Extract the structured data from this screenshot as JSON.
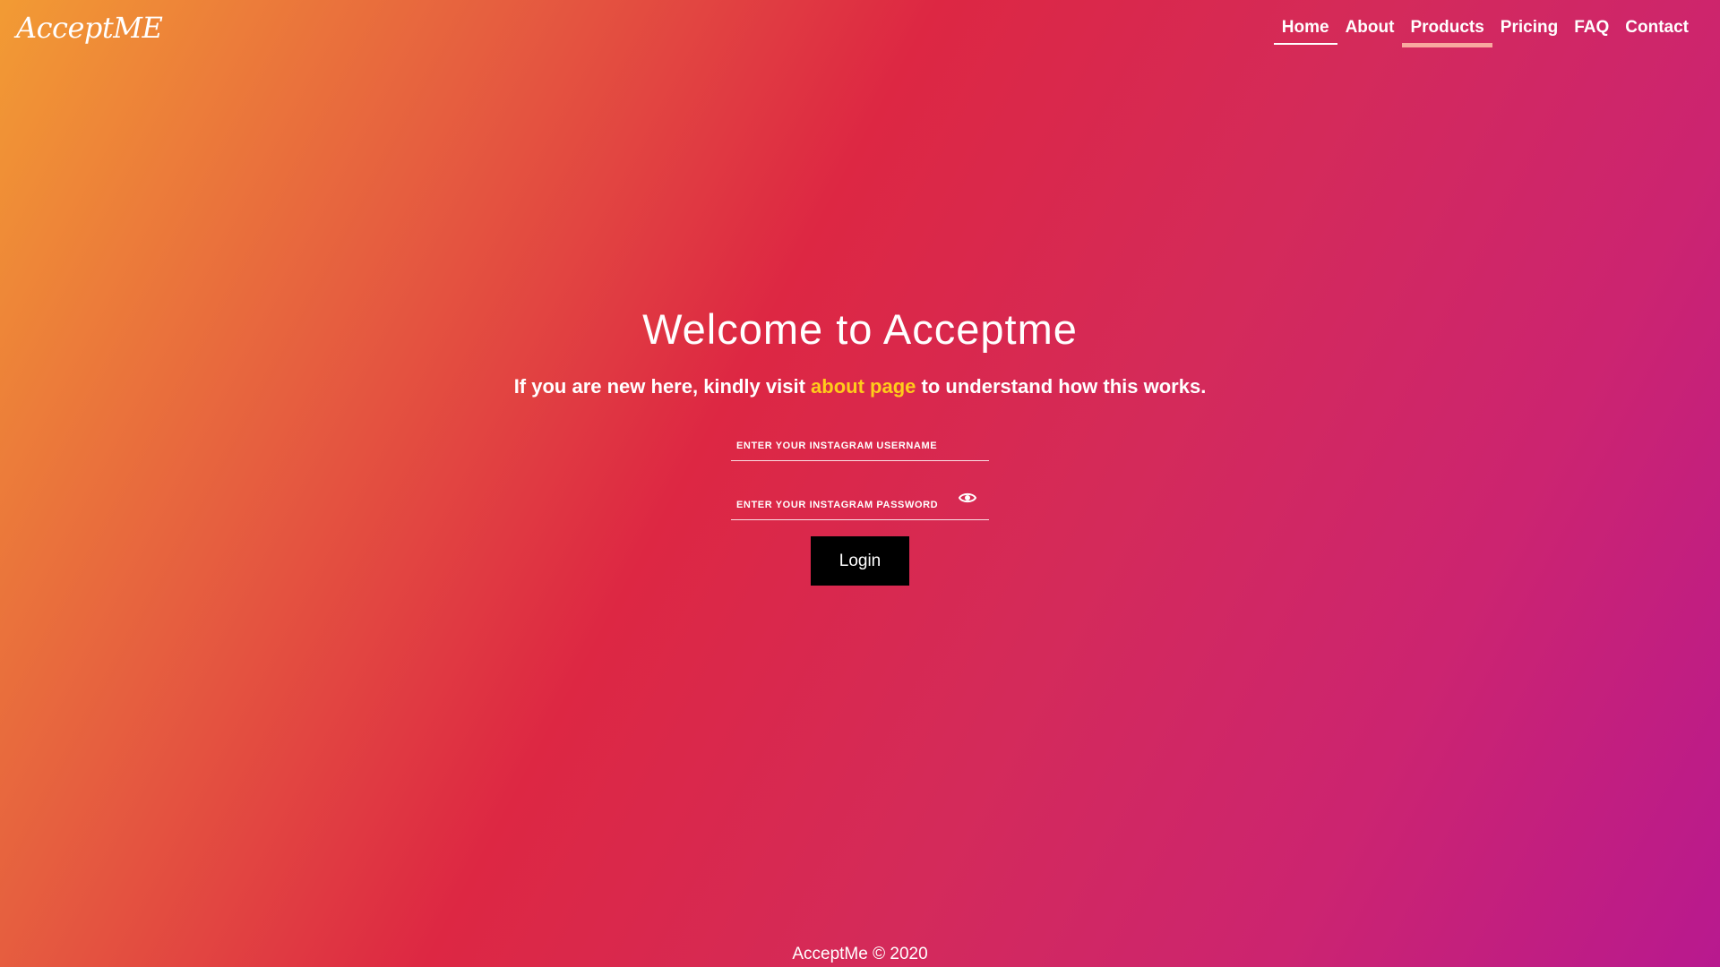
{
  "header": {
    "logo": "AcceptME",
    "nav": [
      {
        "label": "Home",
        "state": "active"
      },
      {
        "label": "About",
        "state": ""
      },
      {
        "label": "Products",
        "state": "hover"
      },
      {
        "label": "Pricing",
        "state": ""
      },
      {
        "label": "FAQ",
        "state": ""
      },
      {
        "label": "Contact",
        "state": ""
      }
    ]
  },
  "main": {
    "title": "Welcome to Acceptme",
    "subtitle_prefix": "If you are new here, kindly visit",
    "subtitle_link": "about page",
    "subtitle_suffix": "to understand how this works.",
    "username": {
      "value": "",
      "placeholder": "ENTER YOUR INSTAGRAM USERNAME"
    },
    "password": {
      "value": "",
      "placeholder": "ENTER YOUR INSTAGRAM PASSWORD",
      "toggle_icon": "eye-icon"
    },
    "login_label": "Login"
  },
  "footer": {
    "text": "AcceptMe © 2020"
  },
  "colors": {
    "link": "#ffcc1a",
    "button_bg": "#000000",
    "gradient_start": "#f29b34",
    "gradient_mid": "#dd2743",
    "gradient_end": "#b8198f"
  }
}
